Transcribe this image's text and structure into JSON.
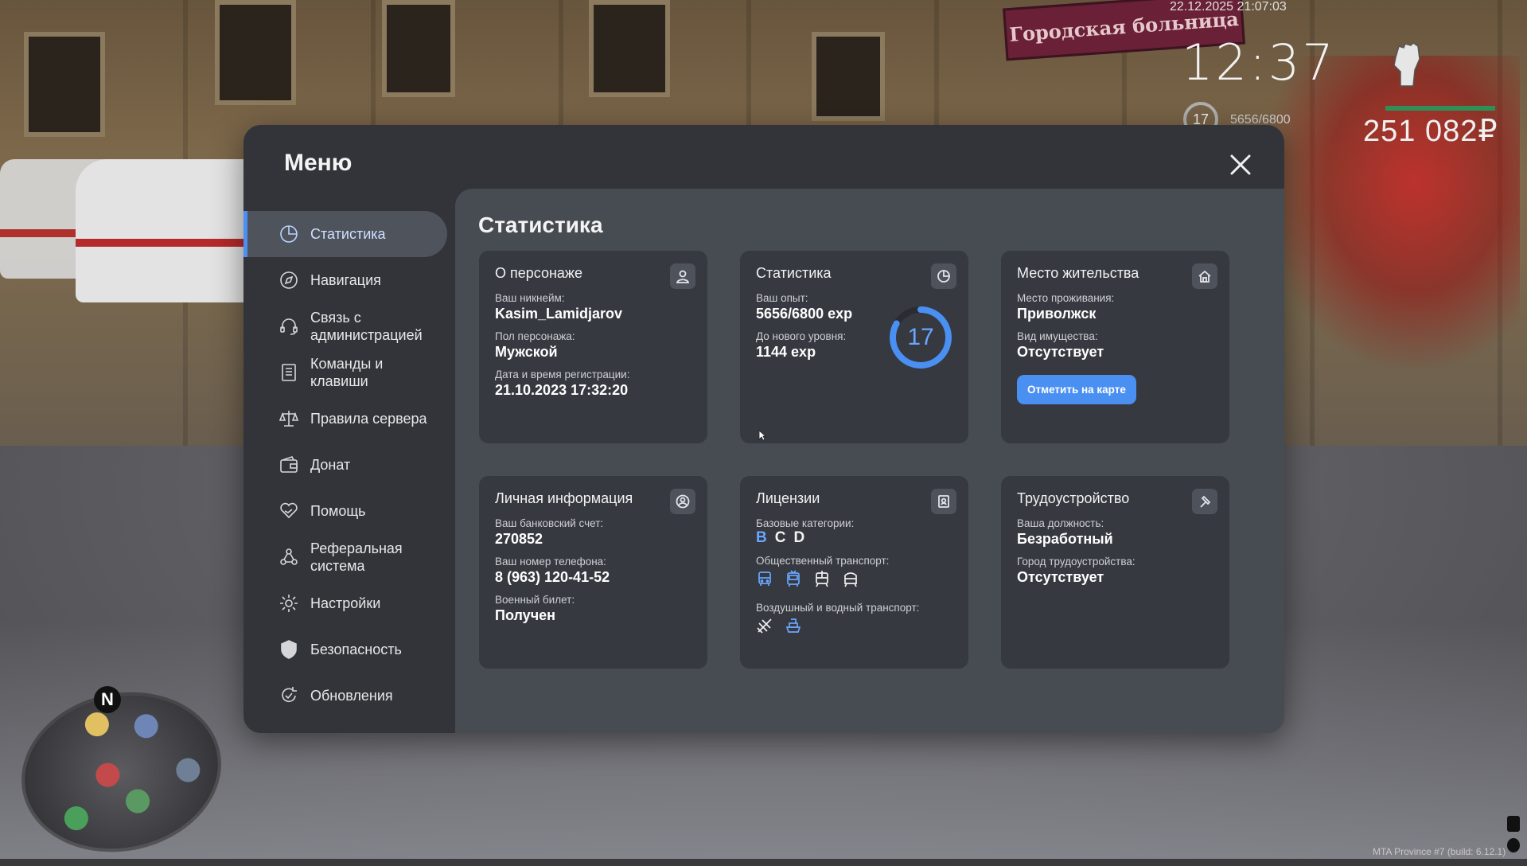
{
  "hud": {
    "datetime": "22.12.2025 21:07:03",
    "clock": "12:37",
    "level": "17",
    "exp": "5656/6800",
    "money": "251 082₽",
    "watermark": "MTA Province #7 (build: 6.12.1)",
    "sign_text": "Городская больница"
  },
  "menu": {
    "title": "Меню",
    "close_icon": "close-icon",
    "nav": [
      {
        "label": "Статистика",
        "icon": "clock-icon",
        "active": true
      },
      {
        "label": "Навигация",
        "icon": "compass-icon"
      },
      {
        "label": "Связь с администрацией",
        "icon": "headset-icon"
      },
      {
        "label": "Команды и клавиши",
        "icon": "list-icon"
      },
      {
        "label": "Правила сервера",
        "icon": "scales-icon"
      },
      {
        "label": "Донат",
        "icon": "wallet-icon"
      },
      {
        "label": "Помощь",
        "icon": "heart-hand-icon"
      },
      {
        "label": "Реферальная система",
        "icon": "referral-icon"
      },
      {
        "label": "Настройки",
        "icon": "gear-icon"
      },
      {
        "label": "Безопасность",
        "icon": "shield-icon"
      },
      {
        "label": "Обновления",
        "icon": "refresh-icon"
      }
    ]
  },
  "content": {
    "title": "Статистика",
    "character": {
      "title": "О персонаже",
      "nick_label": "Ваш никнейм:",
      "nick": "Kasim_Lamidjarov",
      "gender_label": "Пол персонажа:",
      "gender": "Мужской",
      "reg_label": "Дата и время регистрации:",
      "reg": "21.10.2023 17:32:20"
    },
    "stats": {
      "title": "Статистика",
      "exp_label": "Ваш опыт:",
      "exp": "5656/6800 exp",
      "next_label": "До нового уровня:",
      "next": "1144 exp",
      "level": "17",
      "level_progress": 0.832
    },
    "residence": {
      "title": "Место жительства",
      "place_label": "Место проживания:",
      "place": "Приволжск",
      "property_label": "Вид имущества:",
      "property": "Отсутствует",
      "button": "Отметить на карте"
    },
    "personal": {
      "title": "Личная информация",
      "bank_label": "Ваш банковский счет:",
      "bank": "270852",
      "phone_label": "Ваш номер телефона:",
      "phone": "8 (963) 120-41-52",
      "military_label": "Военный билет:",
      "military": "Получен"
    },
    "licenses": {
      "title": "Лицензии",
      "base_label": "Базовые категории:",
      "categories": [
        {
          "name": "B",
          "active": true
        },
        {
          "name": "C",
          "active": false
        },
        {
          "name": "D",
          "active": false
        }
      ],
      "public_label": "Общественный транспорт:",
      "public_icons": [
        {
          "name": "bus-icon",
          "active": true
        },
        {
          "name": "trolleybus-icon",
          "active": true
        },
        {
          "name": "tram-icon",
          "active": false
        },
        {
          "name": "metro-icon",
          "active": false
        }
      ],
      "air_label": "Воздушный и водный транспорт:",
      "air_icons": [
        {
          "name": "plane-icon",
          "active": false
        },
        {
          "name": "boat-icon",
          "active": true
        }
      ]
    },
    "employment": {
      "title": "Трудоустройство",
      "position_label": "Ваша должность:",
      "position": "Безработный",
      "city_label": "Город трудоустройства:",
      "city": "Отсутствует"
    }
  },
  "colors": {
    "accent": "#4a8ff2",
    "modal_bg": "#323439",
    "content_bg": "#474b52",
    "card_bg": "#363940"
  }
}
